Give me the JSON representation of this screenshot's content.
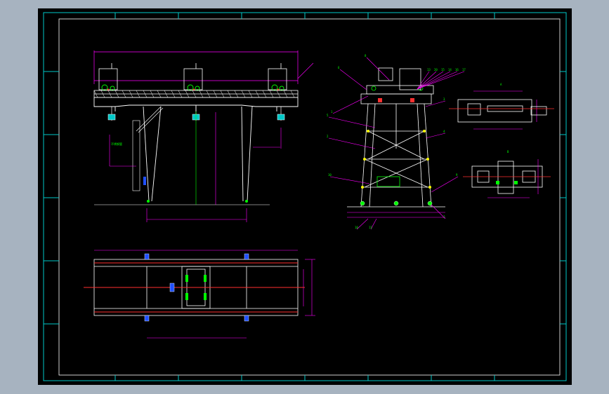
{
  "drawing": {
    "background": "#000000",
    "colors": {
      "frame": "#00c8c8",
      "structure": "#ffffff",
      "dimension": "#ff00ff",
      "leader": "#ff00ff",
      "center": "#ff3030",
      "green": "#00ff00",
      "yellow": "#ffff00",
      "blue": "#2050ff"
    },
    "side_labels": {
      "chinese_note": "不锈钢管"
    },
    "tower_balloons": [
      "8",
      "1",
      "6",
      "5",
      "2",
      "10",
      "18",
      "11",
      "13",
      "20",
      "15",
      "14",
      "16",
      "17",
      "3",
      "4",
      "9",
      "7"
    ],
    "detail_labels": [
      "A",
      "B"
    ]
  }
}
